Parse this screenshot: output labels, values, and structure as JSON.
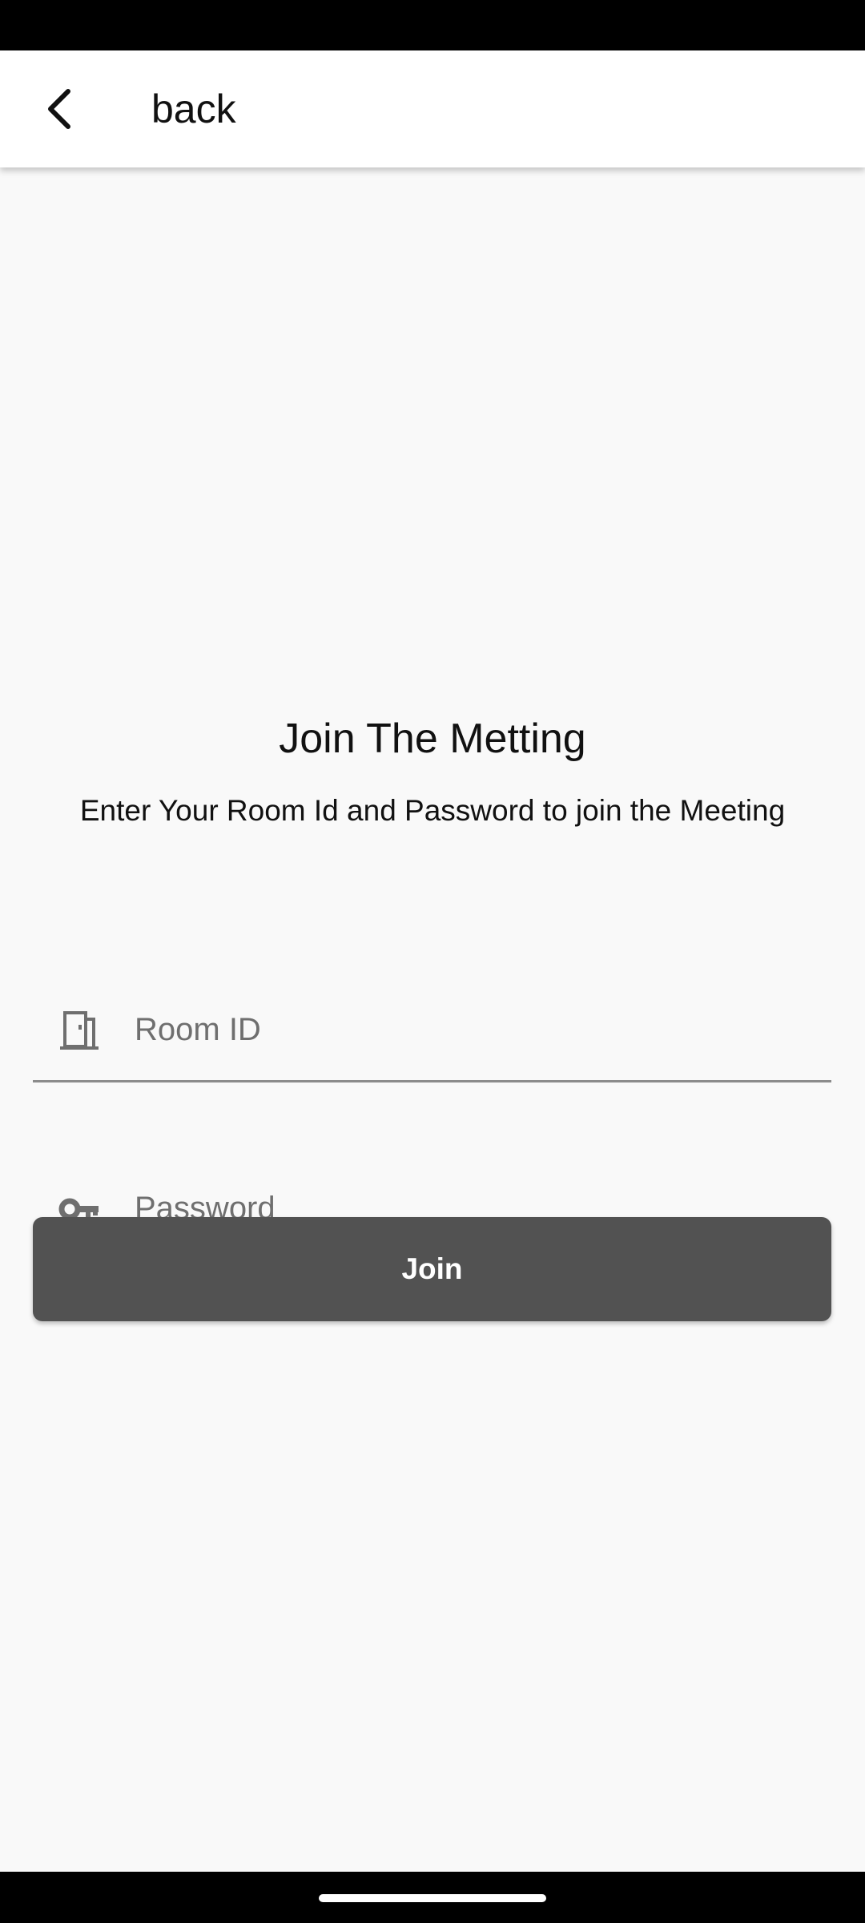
{
  "app_bar": {
    "title": "back",
    "back_icon": "chevron-left-icon"
  },
  "main": {
    "heading": "Join The Metting",
    "subheading": "Enter Your Room Id and Password to join the Meeting",
    "room_id": {
      "placeholder": "Room ID",
      "value": "",
      "icon": "door-icon"
    },
    "password": {
      "placeholder": "Password",
      "value": "",
      "icon": "key-icon"
    },
    "join_label": "Join"
  },
  "colors": {
    "background": "#f9f9f9",
    "app_bar": "#ffffff",
    "button": "#525252",
    "button_text": "#ffffff",
    "icon": "#6f6f6f",
    "underline": "#8c8c8c"
  }
}
